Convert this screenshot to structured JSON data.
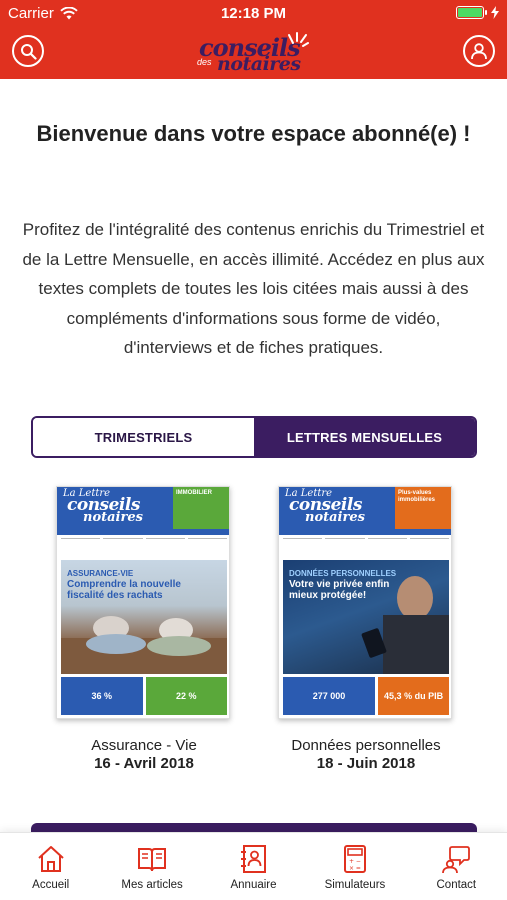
{
  "status_bar": {
    "carrier": "Carrier",
    "time": "12:18 PM"
  },
  "header": {
    "logo": {
      "line1": "conseils",
      "line2": "des",
      "line3": "notaires"
    },
    "search_icon": "search-icon",
    "profile_icon": "user-icon",
    "color": "#e0311f"
  },
  "main": {
    "welcome_title": "Bienvenue dans votre espace abonné(e) !",
    "intro_text": "Profitez de l'intégralité des contenus enrichis du Trimestriel et de la Lettre Mensuelle, en accès illimité. Accédez en plus aux textes complets de toutes les lois citées mais aussi à des compléments d'informations sous forme de vidéo, d'interviews et de fiches pratiques.",
    "tabs": [
      {
        "label": "TRIMESTRIELS",
        "active": false
      },
      {
        "label": "LETTRES MENSUELLES",
        "active": true
      }
    ],
    "accent_color": "#3b1d61",
    "magazines": [
      {
        "cover_lettre": "La Lettre",
        "cover_brand1": "conseils",
        "cover_brand2": "notaires",
        "cover_badge": "IMMOBILIER",
        "cover_headline_kicker": "ASSURANCE-VIE",
        "cover_headline": "Comprendre la nouvelle fiscalité des rachats",
        "cover_stat1": "36 %",
        "cover_stat2": "22 %",
        "title": "Assurance - Vie",
        "date": "16 - Avril 2018"
      },
      {
        "cover_lettre": "La Lettre",
        "cover_brand1": "conseils",
        "cover_brand2": "notaires",
        "cover_badge": "Plus-values immobilières",
        "cover_headline_kicker": "DONNÉES PERSONNELLES",
        "cover_headline": "Votre vie privée enfin mieux protégée!",
        "cover_stat1": "277 000",
        "cover_stat2": "45,3 % du PIB",
        "title": "Données personnelles",
        "date": "18 - Juin 2018"
      }
    ]
  },
  "tabbar": [
    {
      "label": "Accueil",
      "icon": "home-icon"
    },
    {
      "label": "Mes articles",
      "icon": "book-icon"
    },
    {
      "label": "Annuaire",
      "icon": "directory-icon"
    },
    {
      "label": "Simulateurs",
      "icon": "calculator-icon"
    },
    {
      "label": "Contact",
      "icon": "chat-icon"
    }
  ]
}
